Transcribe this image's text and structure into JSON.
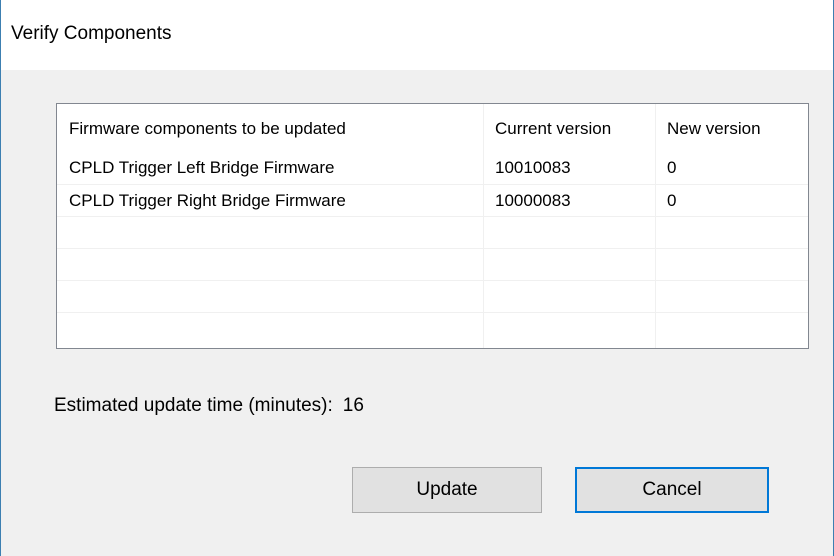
{
  "window": {
    "title": "Verify Components"
  },
  "table": {
    "columns": [
      "Firmware components to be updated",
      "Current version",
      "New version"
    ],
    "rows": [
      [
        "CPLD Trigger Left Bridge Firmware",
        "10010083",
        "0"
      ],
      [
        "CPLD Trigger Right Bridge Firmware",
        "10000083",
        "0"
      ]
    ]
  },
  "estimate": {
    "label": "Estimated update time (minutes):",
    "value": "16"
  },
  "buttons": {
    "update": "Update",
    "cancel": "Cancel"
  },
  "colors": {
    "accent": "#0078d7",
    "frame_border": "#3c7fb1"
  }
}
